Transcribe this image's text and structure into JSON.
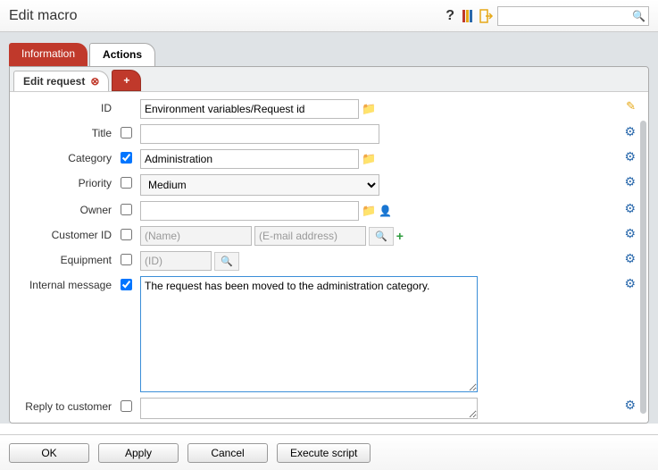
{
  "window": {
    "title": "Edit macro"
  },
  "tabs": {
    "information": "Information",
    "actions": "Actions"
  },
  "subtab": {
    "edit_request": "Edit request",
    "add": "+"
  },
  "form": {
    "id": {
      "label": "ID",
      "value": "Environment variables/Request id"
    },
    "title": {
      "label": "Title",
      "value": ""
    },
    "category": {
      "label": "Category",
      "value": "Administration"
    },
    "priority": {
      "label": "Priority",
      "value": "Medium"
    },
    "owner": {
      "label": "Owner",
      "value": ""
    },
    "customer_id": {
      "label": "Customer ID",
      "name_ph": "(Name)",
      "email_ph": "(E-mail address)"
    },
    "equipment": {
      "label": "Equipment",
      "id_ph": "(ID)"
    },
    "internal_message": {
      "label": "Internal message",
      "value": "The request has been moved to the administration category."
    },
    "reply": {
      "label": "Reply to customer",
      "value": ""
    }
  },
  "buttons": {
    "ok": "OK",
    "apply": "Apply",
    "cancel": "Cancel",
    "execute": "Execute script"
  }
}
